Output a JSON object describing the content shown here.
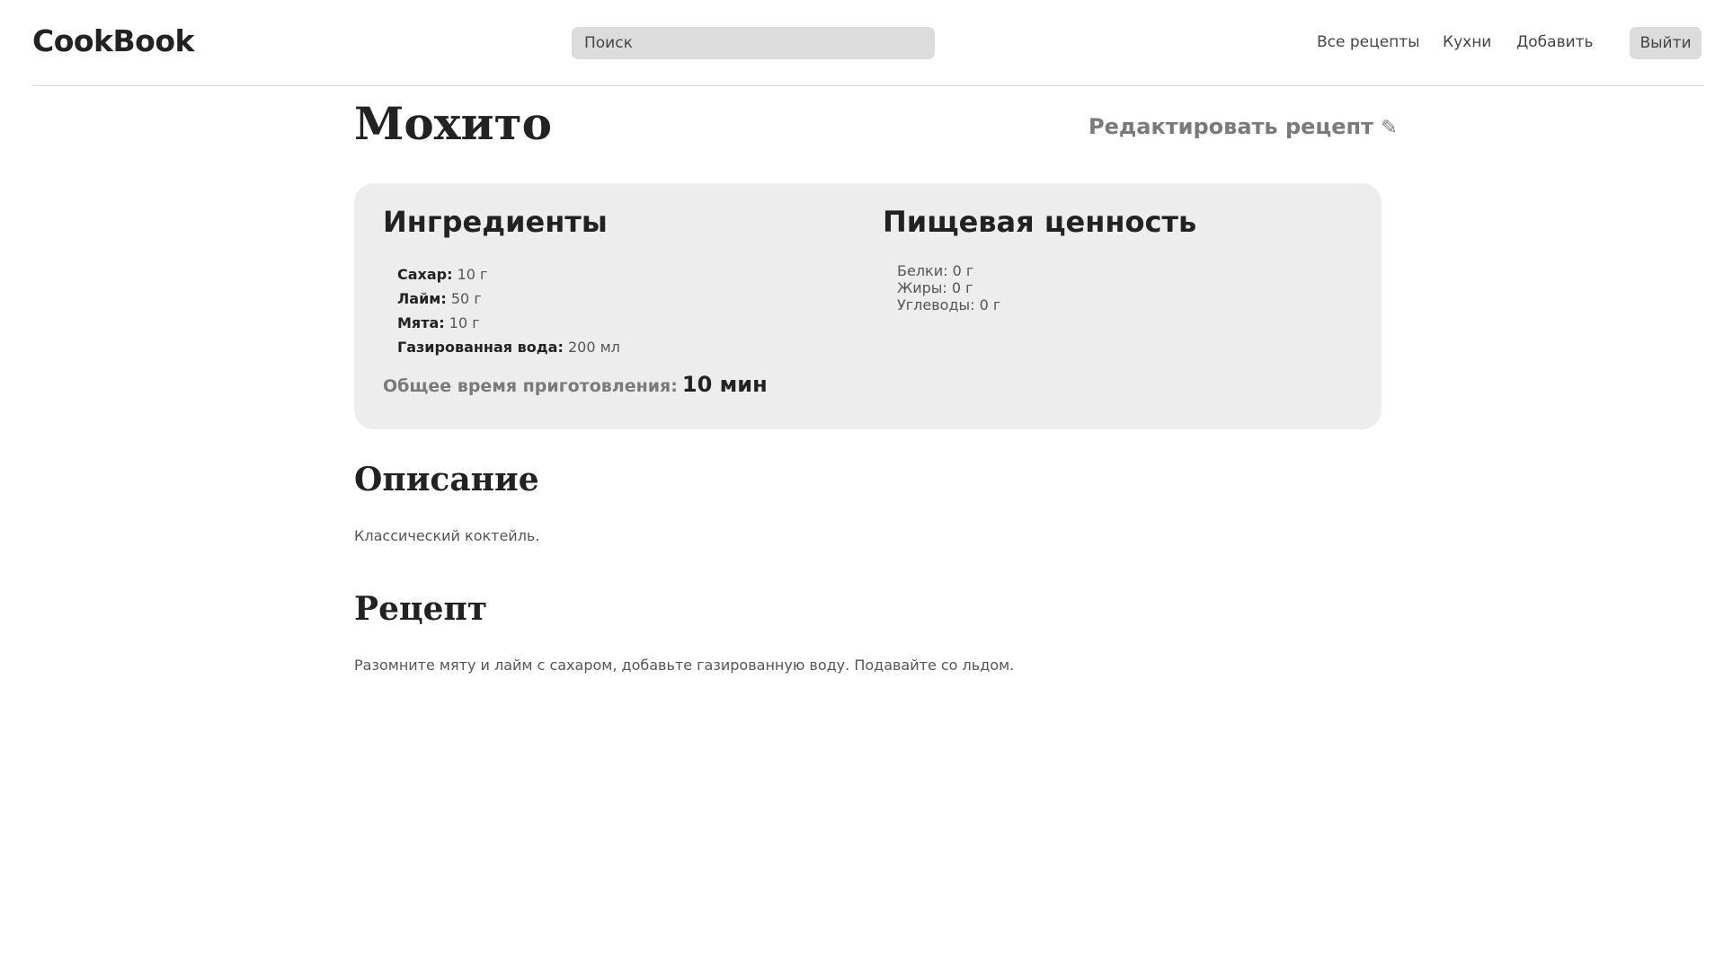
{
  "header": {
    "logo": "CookBook",
    "search_placeholder": "Поиск",
    "nav": {
      "all_recipes": "Все рецепты",
      "cuisines": "Кухни",
      "add": "Добавить"
    },
    "logout": "Выйти"
  },
  "recipe": {
    "title": "Мохито",
    "edit_label": "Редактировать рецепт",
    "edit_icon": "pencil-icon",
    "ingredients_title": "Ингредиенты",
    "ingredients": [
      {
        "name": "Сахар:",
        "amount": "10 г"
      },
      {
        "name": "Лайм:",
        "amount": "50 г"
      },
      {
        "name": "Мята:",
        "amount": "10 г"
      },
      {
        "name": "Газированная вода:",
        "amount": "200 мл"
      }
    ],
    "nutrition_title": "Пищевая ценность",
    "nutrition": [
      "Белки: 0 г",
      "Жиры: 0 г",
      "Углеводы: 0 г"
    ],
    "total_time_label": "Общее время приготовления:",
    "total_time_value": "10 мин",
    "description_title": "Описание",
    "description": "Классический коктейль.",
    "method_title": "Рецепт",
    "method": "Разомните мяту и лайм с сахаром, добавьте газированную воду. Подавайте со льдом."
  },
  "colors": {
    "card_background": "#ededed",
    "button_background": "#dcdcdc",
    "muted_text": "#7a7a7a"
  }
}
